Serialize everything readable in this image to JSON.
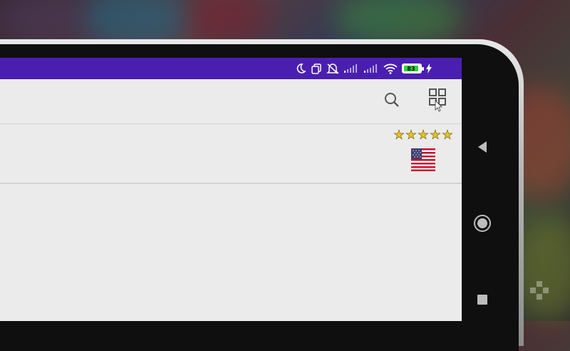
{
  "status_bar": {
    "battery_level": "83",
    "icons": [
      "moon-icon",
      "dual-sim-icon",
      "mute-icon",
      "signal-icon",
      "signal-icon",
      "wifi-icon",
      "battery-icon",
      "charging-icon"
    ]
  },
  "toolbar": {
    "search_icon": "search-icon",
    "grid_icon": "grid-view-icon"
  },
  "list_item": {
    "rating": 5,
    "rating_max": 5,
    "country_flag": "us-flag-icon"
  },
  "navigation": {
    "back_icon": "back-triangle-icon",
    "home_icon": "home-circle-icon",
    "recents_icon": "recents-square-icon"
  },
  "colors": {
    "status_bar": "#4a1fb0",
    "screen_bg": "#ebebeb",
    "star": "#e8c619",
    "battery_fill": "#2fd13a"
  }
}
